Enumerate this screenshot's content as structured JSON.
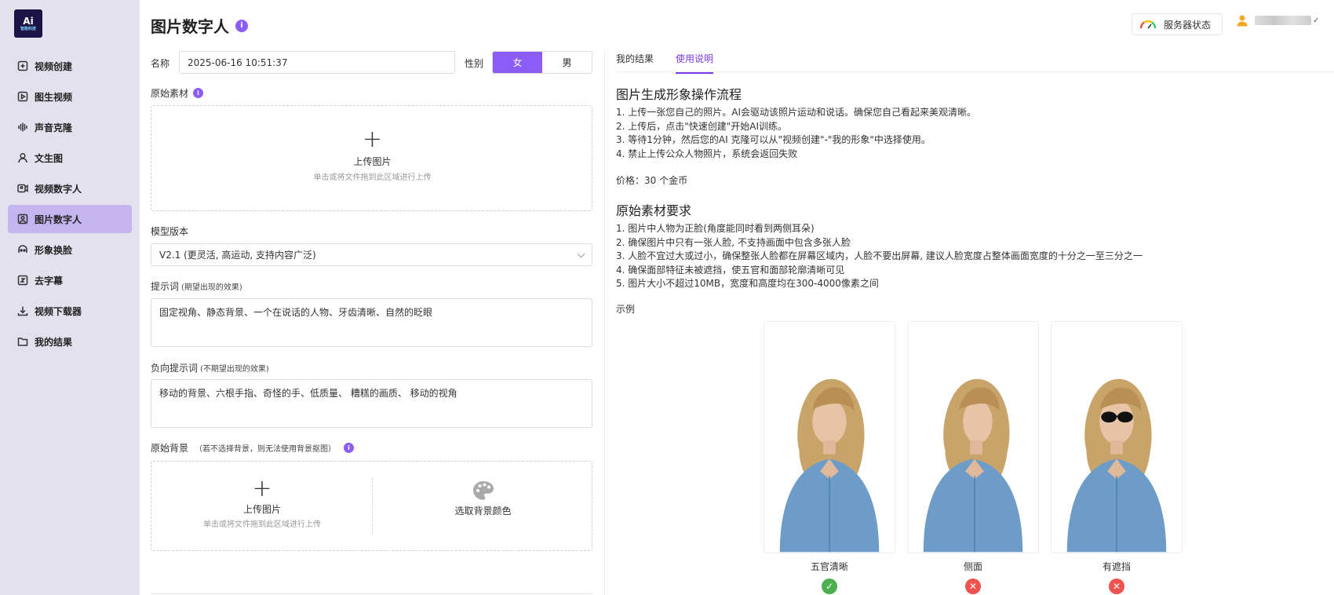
{
  "sidebar": {
    "logo_text": "Ai",
    "logo_sub": "智能科技",
    "items": [
      {
        "label": "视频创建",
        "icon": "plus-square-icon"
      },
      {
        "label": "图生视频",
        "icon": "video-play-icon"
      },
      {
        "label": "声音克隆",
        "icon": "sound-wave-icon"
      },
      {
        "label": "文生图",
        "icon": "person-icon"
      },
      {
        "label": "视频数字人",
        "icon": "video-avatar-icon"
      },
      {
        "label": "图片数字人",
        "icon": "image-avatar-icon",
        "active": true
      },
      {
        "label": "形象换脸",
        "icon": "face-swap-icon"
      },
      {
        "label": "去字幕",
        "icon": "subtitle-remove-icon"
      },
      {
        "label": "视频下载器",
        "icon": "download-icon"
      },
      {
        "label": "我的结果",
        "icon": "folder-icon"
      }
    ]
  },
  "header": {
    "title": "图片数字人",
    "info_glyph": "i",
    "server_status": "服务器状态",
    "user_chevron": "✓"
  },
  "form": {
    "name_label": "名称",
    "name_value": "2025-06-16 10:51:37",
    "gender_label": "性别",
    "gender_female": "女",
    "gender_male": "男",
    "source_label": "原始素材",
    "upload_plus": "+",
    "upload_title": "上传图片",
    "upload_hint": "单击或将文件拖到此区域进行上传",
    "model_label": "模型版本",
    "model_value": "V2.1 (更灵活, 高运动, 支持内容广泛)",
    "prompt_label": "提示词",
    "prompt_hint": "(期望出现的效果)",
    "prompt_value": "固定视角、静态背景、一个在说话的人物、牙齿清晰、自然的眨眼",
    "neg_label": "负向提示词",
    "neg_hint": "(不期望出现的效果)",
    "neg_value": "移动的背景、六根手指、奇怪的手、低质量、 糟糕的画质、 移动的视角",
    "bg_label": "原始背景",
    "bg_hint": "（若不选择背景，则无法使用背景抠图）",
    "bg_upload_plus": "+",
    "bg_upload_title": "上传图片",
    "bg_upload_hint": "单击或将文件拖到此区域进行上传",
    "bg_color_label": "选取背景颜色"
  },
  "right": {
    "tabs": [
      "我的结果",
      "使用说明"
    ],
    "active_tab": 1,
    "flow_title": "图片生成形象操作流程",
    "flow_steps": [
      "1. 上传一张您自己的照片。AI会驱动该照片运动和说话。确保您自己看起来美观清晰。",
      "2. 上传后，点击\"快速创建\"开始AI训练。",
      "3. 等待1分钟，然后您的AI 克隆可以从\"视频创建\"-\"我的形象\"中选择使用。",
      "4. 禁止上传公众人物照片，系统会返回失败"
    ],
    "price": "价格：30 个金币",
    "req_title": "原始素材要求",
    "req_steps": [
      "1. 图片中人物为正脸(角度能同时看到两侧耳朵)",
      "2. 确保图片中只有一张人脸, 不支持画面中包含多张人脸",
      "3. 人脸不宜过大或过小，确保整张人脸都在屏幕区域内，人脸不要出屏幕, 建议人脸宽度占整体画面宽度的十分之一至三分之一",
      "4. 确保面部特征未被遮挡，使五官和面部轮廓清晰可见",
      "5. 图片大小不超过10MB，宽度和高度均在300-4000像素之间"
    ],
    "example_label": "示例",
    "examples": [
      {
        "caption": "五官清晰",
        "mark": "✓",
        "status": "ok"
      },
      {
        "caption": "侧面",
        "mark": "✕",
        "status": "bad"
      },
      {
        "caption": "有遮挡",
        "mark": "✕",
        "status": "bad"
      }
    ]
  },
  "colors": {
    "accent": "#8b5cf6",
    "sidebar_bg": "#e4e1ee",
    "active_nav": "#c4b4f0",
    "ok": "#4caf50",
    "bad": "#ef5350"
  }
}
